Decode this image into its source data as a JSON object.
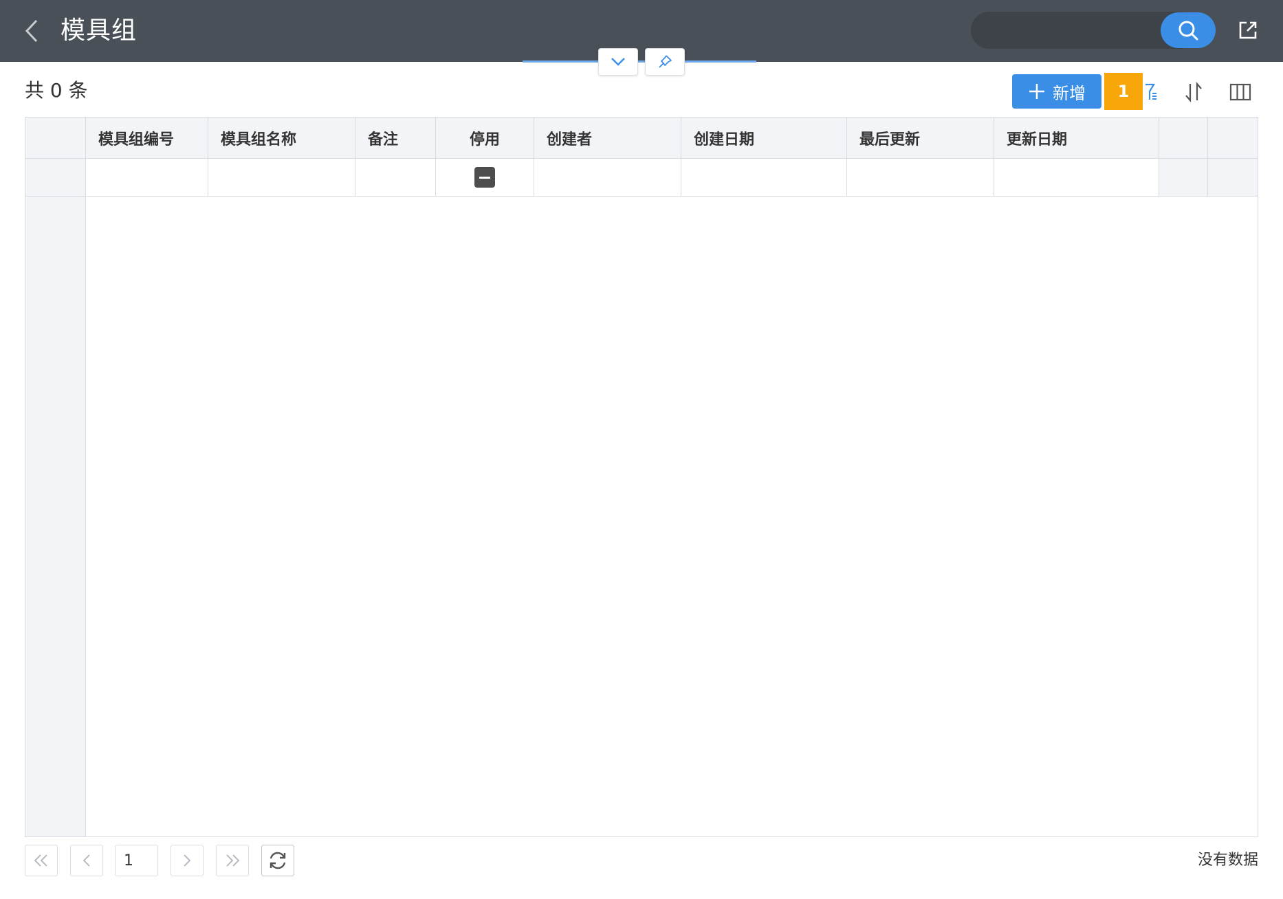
{
  "header": {
    "title": "模具组",
    "search_placeholder": ""
  },
  "toolbar": {
    "total_text": "共 0 条",
    "add_label": "新增",
    "badge_count": "1"
  },
  "table": {
    "columns": [
      "模具组编号",
      "模具组名称",
      "备注",
      "停用",
      "创建者",
      "创建日期",
      "最后更新",
      "更新日期"
    ]
  },
  "pager": {
    "page": "1",
    "status": "没有数据"
  },
  "colors": {
    "header_bg": "#4a5057",
    "accent": "#3a8ee6",
    "badge": "#f7a70a"
  },
  "icons": [
    "back-icon",
    "search-icon",
    "export-icon",
    "chevron-down-icon",
    "pin-icon",
    "plus-icon",
    "filter-icon",
    "sort-icon",
    "columns-icon",
    "first-page-icon",
    "prev-page-icon",
    "next-page-icon",
    "last-page-icon",
    "refresh-icon"
  ]
}
